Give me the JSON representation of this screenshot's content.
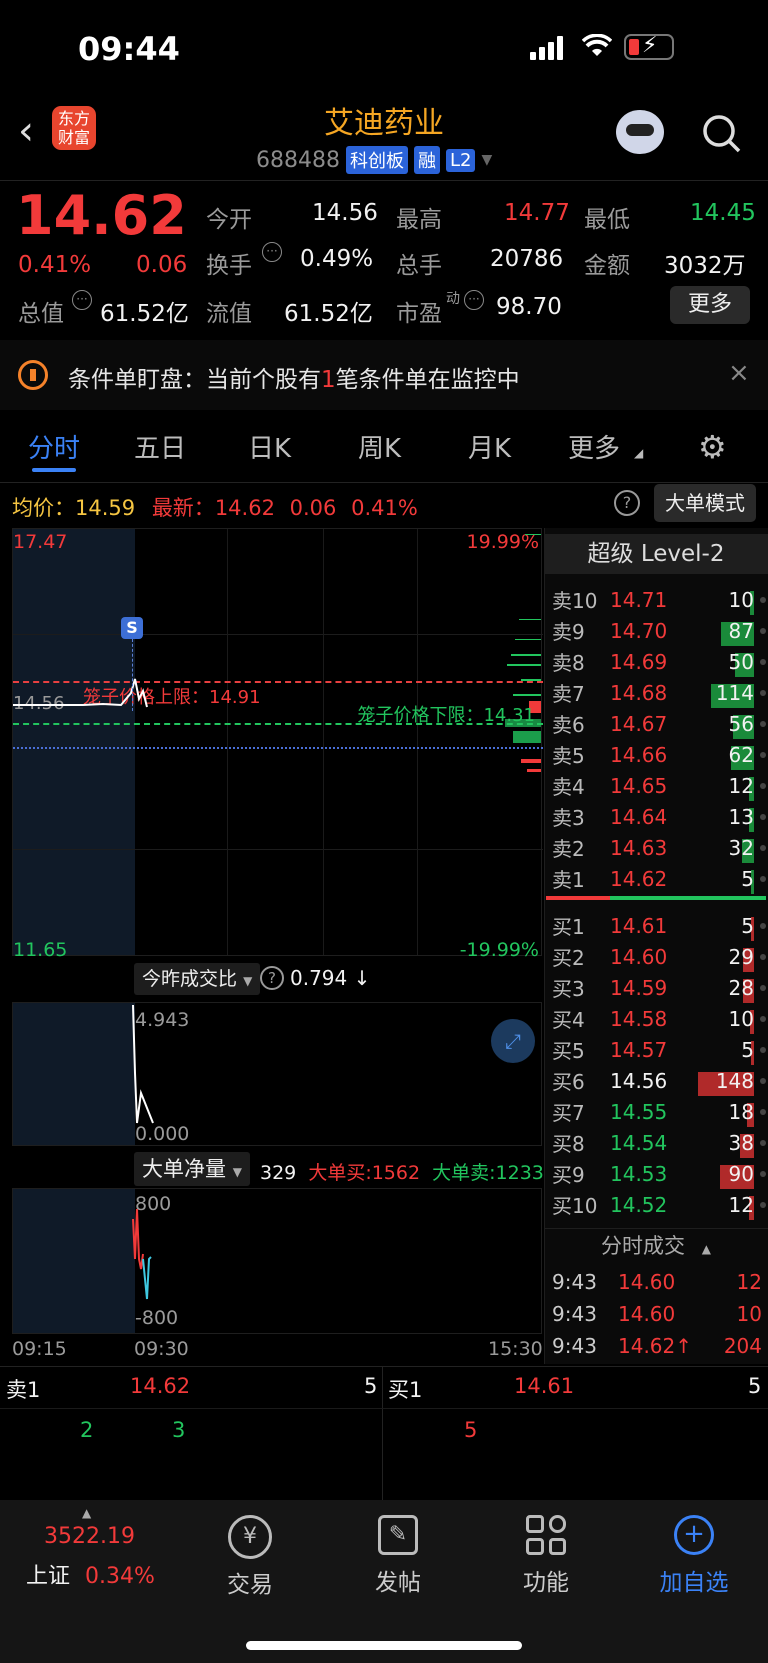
{
  "status": {
    "time": "09:44"
  },
  "header": {
    "logo": "东方\n财富",
    "logo_line1": "东方",
    "logo_line2": "财富",
    "title": "艾迪药业",
    "code": "688488",
    "tags": [
      "科创板",
      "融",
      "L2"
    ]
  },
  "quote": {
    "price": "14.62",
    "change_pct": "0.41%",
    "change": "0.06",
    "open_label": "今开",
    "open": "14.56",
    "high_label": "最高",
    "high": "14.77",
    "low_label": "最低",
    "low": "14.45",
    "turnover_label": "换手",
    "turnover": "0.49%",
    "volume_label": "总手",
    "volume": "20786",
    "amount_label": "金额",
    "amount": "3032万",
    "mktcap_label": "总值",
    "mktcap": "61.52亿",
    "float_label": "流值",
    "float": "61.52亿",
    "pe_label": "市盈",
    "pe_sup": "动",
    "pe": "98.70",
    "more_button": "更多"
  },
  "notice": {
    "prefix": "条件单盯盘：当前个股有",
    "count": "1",
    "suffix": "笔条件单在监控中"
  },
  "tabs": [
    "分时",
    "五日",
    "日K",
    "周K",
    "月K",
    "更多"
  ],
  "info_bar": {
    "avg_label": "均价：",
    "avg": "14.59",
    "latest_label": "最新：",
    "latest": "14.62",
    "latest_change": "0.06",
    "latest_pct": "0.41%",
    "mode_button": "大单模式"
  },
  "chart": {
    "y_max": "17.47",
    "y_min": "11.65",
    "pct_max": "19.99%",
    "pct_min": "-19.99%",
    "prev_close": "14.56",
    "cage_upper": "笼子价格上限：14.91",
    "cage_lower": "笼子价格下限：14.31",
    "s_marker": "S",
    "ratio_label": "今昨成交比",
    "ratio_value": "0.794 ↓",
    "ratio_max": "4.943",
    "ratio_min": "0.000",
    "big_label": "大单净量",
    "big_value": "329",
    "big_buy": "大单买:1562",
    "big_sell": "大单卖:1233",
    "big_max": "800",
    "big_min": "-800",
    "time_start": "09:15",
    "time_mid": "09:30",
    "time_end": "15:30"
  },
  "orderbook": {
    "title": "超级 Level-2",
    "asks": [
      {
        "label": "卖10",
        "price": "14.71",
        "vol": "10"
      },
      {
        "label": "卖9",
        "price": "14.70",
        "vol": "87"
      },
      {
        "label": "卖8",
        "price": "14.69",
        "vol": "50"
      },
      {
        "label": "卖7",
        "price": "14.68",
        "vol": "114"
      },
      {
        "label": "卖6",
        "price": "14.67",
        "vol": "56"
      },
      {
        "label": "卖5",
        "price": "14.66",
        "vol": "62"
      },
      {
        "label": "卖4",
        "price": "14.65",
        "vol": "12"
      },
      {
        "label": "卖3",
        "price": "14.64",
        "vol": "13"
      },
      {
        "label": "卖2",
        "price": "14.63",
        "vol": "32"
      },
      {
        "label": "卖1",
        "price": "14.62",
        "vol": "5"
      }
    ],
    "bids": [
      {
        "label": "买1",
        "price": "14.61",
        "vol": "5"
      },
      {
        "label": "买2",
        "price": "14.60",
        "vol": "29"
      },
      {
        "label": "买3",
        "price": "14.59",
        "vol": "28"
      },
      {
        "label": "买4",
        "price": "14.58",
        "vol": "10"
      },
      {
        "label": "买5",
        "price": "14.57",
        "vol": "5"
      },
      {
        "label": "买6",
        "price": "14.56",
        "vol": "148"
      },
      {
        "label": "买7",
        "price": "14.55",
        "vol": "18"
      },
      {
        "label": "买8",
        "price": "14.54",
        "vol": "38"
      },
      {
        "label": "买9",
        "price": "14.53",
        "vol": "90"
      },
      {
        "label": "买10",
        "price": "14.52",
        "vol": "12"
      }
    ],
    "trades_title": "分时成交",
    "trades": [
      {
        "time": "9:43",
        "price": "14.60",
        "vol": "12"
      },
      {
        "time": "9:43",
        "price": "14.60",
        "vol": "10"
      },
      {
        "time": "9:43",
        "price": "14.62↑",
        "vol": "204"
      }
    ]
  },
  "queue": {
    "sell_label": "卖1",
    "sell_price": "14.62",
    "sell_vol": "5",
    "buy_label": "买1",
    "buy_price": "14.61",
    "buy_vol": "5",
    "sell_items": [
      "2",
      "3"
    ],
    "buy_items": [
      "5"
    ]
  },
  "bottom": {
    "index_value": "3522.19",
    "index_name": "上证",
    "index_pct": "0.34%",
    "nav": [
      "交易",
      "发帖",
      "功能",
      "加自选"
    ]
  },
  "colors": {
    "up": "#f23a3a",
    "down": "#22c55e",
    "accent": "#3b82f6",
    "title": "#f5a623"
  }
}
